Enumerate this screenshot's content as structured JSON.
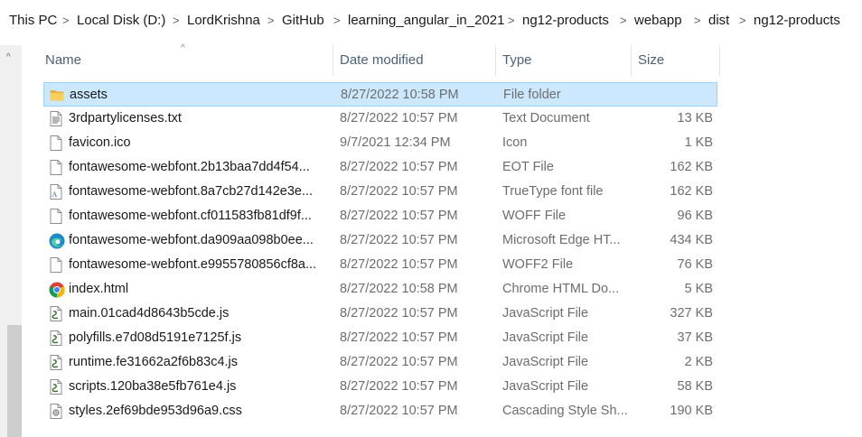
{
  "breadcrumb": [
    "This PC",
    "Local Disk (D:)",
    "LordKrishna",
    "GitHub",
    "learning_angular_in_2021",
    "ng12-products",
    "webapp",
    "dist",
    "ng12-products"
  ],
  "breadcrumb_separator": ">",
  "columns": {
    "name": "Name",
    "date": "Date modified",
    "type": "Type",
    "size": "Size"
  },
  "sort_indicator": "^",
  "scroll_up_arrow": "^",
  "colors": {
    "selection_bg": "#cce8ff",
    "selection_border": "#99d1ff",
    "header_text": "#4c607a",
    "secondary_text": "#6d6d6d"
  },
  "files": [
    {
      "name": "assets",
      "date": "8/27/2022 10:58 PM",
      "type": "File folder",
      "size": "",
      "icon": "folder-icon",
      "selected": true
    },
    {
      "name": "3rdpartylicenses.txt",
      "date": "8/27/2022 10:57 PM",
      "type": "Text Document",
      "size": "13 KB",
      "icon": "text-file-icon"
    },
    {
      "name": "favicon.ico",
      "date": "9/7/2021 12:34 PM",
      "type": "Icon",
      "size": "1 KB",
      "icon": "blank-file-icon"
    },
    {
      "name": "fontawesome-webfont.2b13baa7dd4f54...",
      "date": "8/27/2022 10:57 PM",
      "type": "EOT File",
      "size": "162 KB",
      "icon": "blank-file-icon"
    },
    {
      "name": "fontawesome-webfont.8a7cb27d142e3e...",
      "date": "8/27/2022 10:57 PM",
      "type": "TrueType font file",
      "size": "162 KB",
      "icon": "font-file-icon"
    },
    {
      "name": "fontawesome-webfont.cf011583fb81df9f...",
      "date": "8/27/2022 10:57 PM",
      "type": "WOFF File",
      "size": "96 KB",
      "icon": "blank-file-icon"
    },
    {
      "name": "fontawesome-webfont.da909aa098b0ee...",
      "date": "8/27/2022 10:57 PM",
      "type": "Microsoft Edge HT...",
      "size": "434 KB",
      "icon": "edge-icon"
    },
    {
      "name": "fontawesome-webfont.e9955780856cf8a...",
      "date": "8/27/2022 10:57 PM",
      "type": "WOFF2 File",
      "size": "76 KB",
      "icon": "blank-file-icon"
    },
    {
      "name": "index.html",
      "date": "8/27/2022 10:58 PM",
      "type": "Chrome HTML Do...",
      "size": "5 KB",
      "icon": "chrome-icon"
    },
    {
      "name": "main.01cad4d8643b5cde.js",
      "date": "8/27/2022 10:57 PM",
      "type": "JavaScript File",
      "size": "327 KB",
      "icon": "script-file-icon"
    },
    {
      "name": "polyfills.e7d08d5191e7125f.js",
      "date": "8/27/2022 10:57 PM",
      "type": "JavaScript File",
      "size": "37 KB",
      "icon": "script-file-icon"
    },
    {
      "name": "runtime.fe31662a2f6b83c4.js",
      "date": "8/27/2022 10:57 PM",
      "type": "JavaScript File",
      "size": "2 KB",
      "icon": "script-file-icon"
    },
    {
      "name": "scripts.120ba38e5fb761e4.js",
      "date": "8/27/2022 10:57 PM",
      "type": "JavaScript File",
      "size": "58 KB",
      "icon": "script-file-icon"
    },
    {
      "name": "styles.2ef69bde953d96a9.css",
      "date": "8/27/2022 10:57 PM",
      "type": "Cascading Style Sh...",
      "size": "190 KB",
      "icon": "css-file-icon"
    }
  ]
}
